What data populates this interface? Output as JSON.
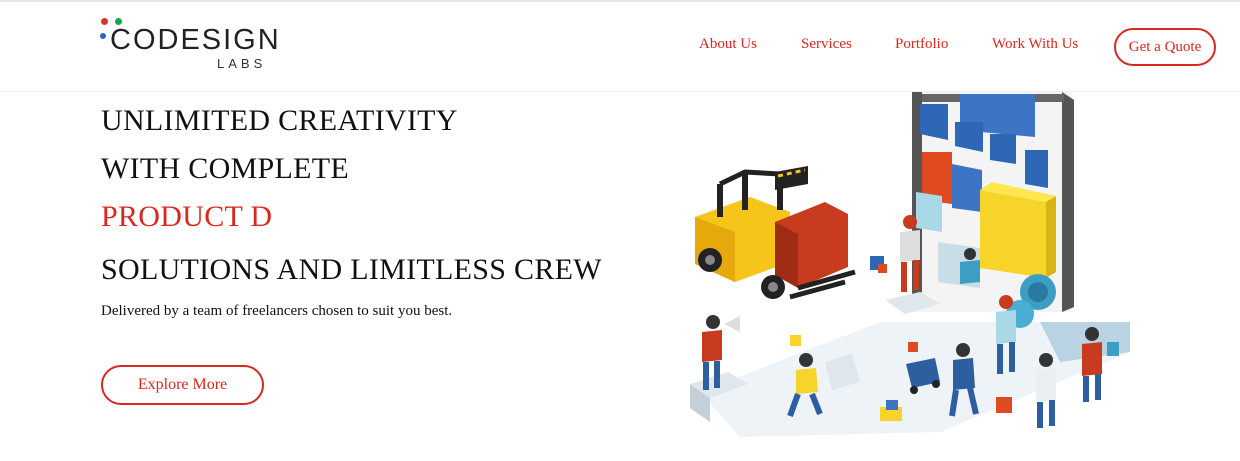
{
  "brand": {
    "name": "CODESIGN",
    "subtitle": "LABS",
    "colors": {
      "red": "#e0302a",
      "green": "#1aa64a",
      "blue": "#3060c0"
    }
  },
  "nav": {
    "items": [
      {
        "label": "About Us"
      },
      {
        "label": "Services"
      },
      {
        "label": "Portfolio"
      },
      {
        "label": "Work With Us"
      }
    ],
    "cta_label": "Get a Quote"
  },
  "hero": {
    "line1": "UNLIMITED CREATIVITY",
    "line2": "WITH COMPLETE",
    "line3": "PRODUCT D",
    "line4": "SOLUTIONS AND LIMITLESS CREW",
    "tagline": "Delivered by a team of freelancers chosen to suit you best.",
    "cta_label": "Explore More"
  },
  "illustration": {
    "icon": "isometric-team-building-app-illustration"
  },
  "theme": {
    "accent": "#d8281f",
    "text": "#111111"
  }
}
